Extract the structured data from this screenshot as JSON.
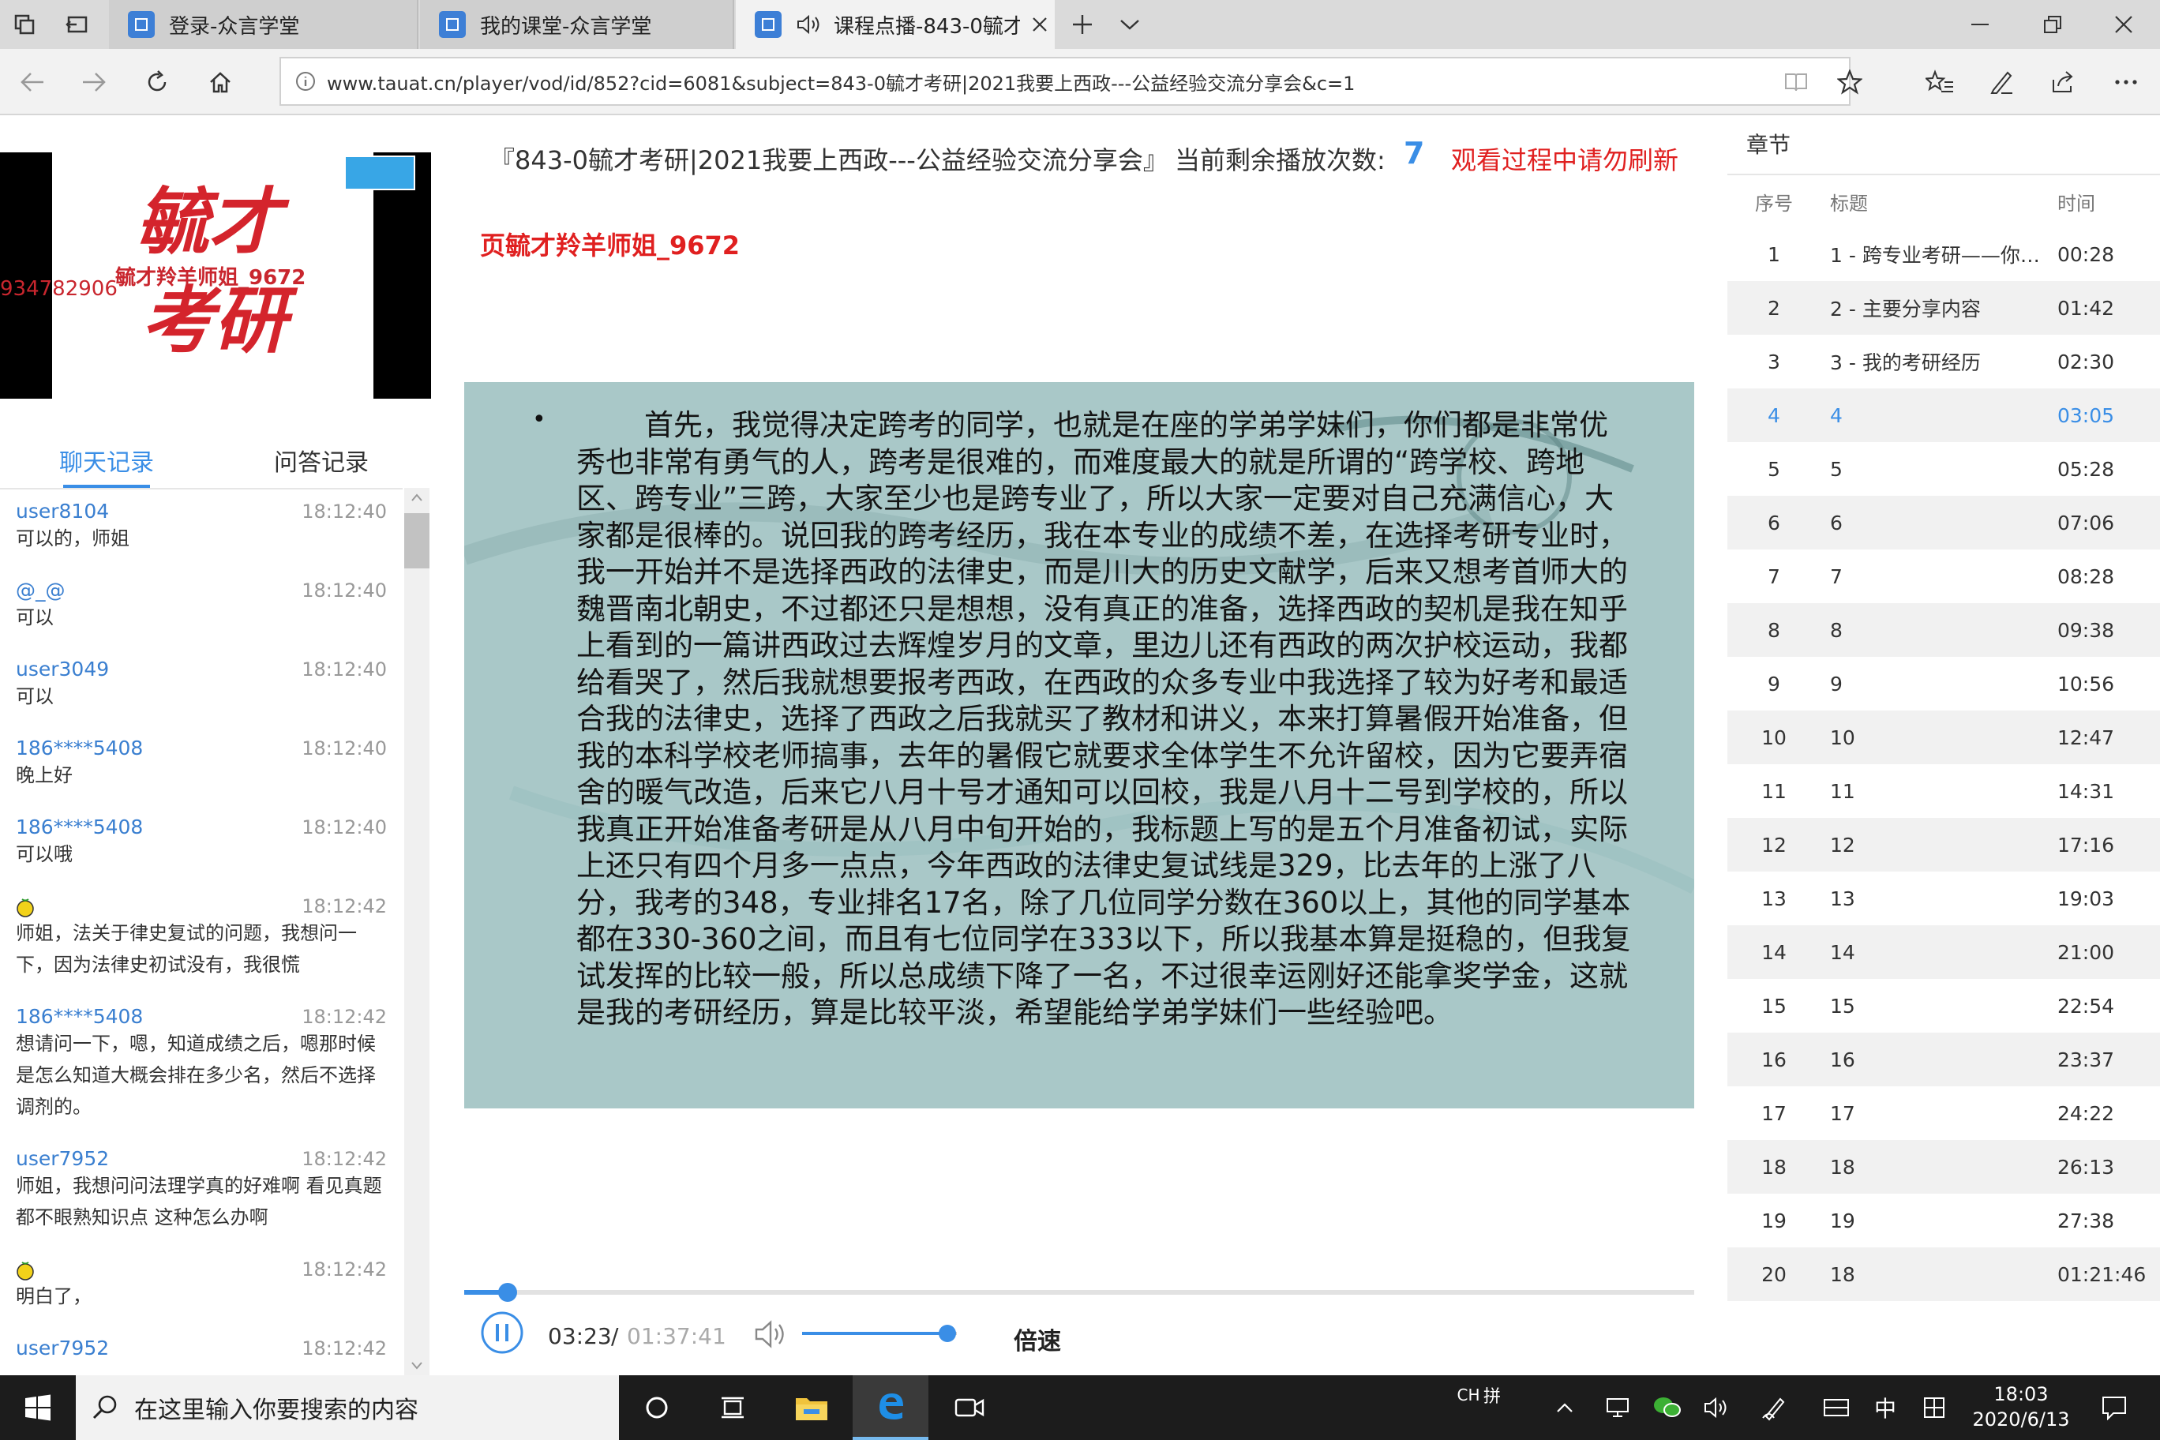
{
  "browser": {
    "tabs": [
      {
        "title": "登录-众言学堂",
        "active": false
      },
      {
        "title": "我的课堂-众言学堂",
        "active": false
      },
      {
        "title": "课程点播-843-0毓才",
        "active": true
      }
    ],
    "url": "www.tauat.cn/player/vod/id/852?cid=6081&subject=843-0毓才考研|2021我要上西政---公益经验交流分享会&c=1"
  },
  "left": {
    "thumb_overlay": "毓才羚羊师姐_9672",
    "thumb_id": "934782906",
    "tabs": {
      "chat": "聊天记录",
      "qa": "问答记录"
    },
    "messages": [
      {
        "user": "user8104",
        "time": "18:12:40",
        "text": "可以的，师姐"
      },
      {
        "user": "@_@",
        "time": "18:12:40",
        "text": "可以"
      },
      {
        "user": "user3049",
        "time": "18:12:40",
        "text": "可以"
      },
      {
        "user": "186****5408",
        "time": "18:12:40",
        "text": "晚上好"
      },
      {
        "user": "186****5408",
        "time": "18:12:40",
        "text": "可以哦"
      },
      {
        "user": "",
        "time": "18:12:42",
        "text": "师姐，法关于律史复试的问题，我想问一下，因为法律史初试没有，我很慌"
      },
      {
        "user": "186****5408",
        "time": "18:12:42",
        "text": "想请问一下，嗯，知道成绩之后，嗯那时候是怎么知道大概会排在多少名，然后不选择调剂的。"
      },
      {
        "user": "user7952",
        "time": "18:12:42",
        "text": "师姐，我想问问法理学真的好难啊 看见真题都不眼熟知识点 这种怎么办啊"
      },
      {
        "user": "",
        "time": "18:12:42",
        "text": "明白了，"
      },
      {
        "user": "user7952",
        "time": "18:12:42",
        "text": ""
      }
    ]
  },
  "player": {
    "course_title": "『843-0毓才考研|2021我要上西政---公益经验交流分享会』",
    "remaining_label": "当前剩余播放次数:",
    "remaining_count": "7",
    "refresh_warning": "观看过程中请勿刷新",
    "watermark": "页毓才羚羊师姐_9672",
    "slide_bullet": "•",
    "slide_text": "首先，我觉得决定跨考的同学，也就是在座的学弟学妹们，你们都是非常优秀也非常有勇气的人，跨考是很难的，而难度最大的就是所谓的“跨学校、跨地区、跨专业”三跨，大家至少也是跨专业了，所以大家一定要对自己充满信心，大家都是很棒的。说回我的跨考经历，我在本专业的成绩不差，在选择考研专业时，我一开始并不是选择西政的法律史，而是川大的历史文献学，后来又想考首师大的魏晋南北朝史，不过都还只是想想，没有真正的准备，选择西政的契机是我在知乎上看到的一篇讲西政过去辉煌岁月的文章，里边儿还有西政的两次护校运动，我都给看哭了，然后我就想要报考西政，在西政的众多专业中我选择了较为好考和最适合我的法律史，选择了西政之后我就买了教材和讲义，本来打算暑假开始准备，但我的本科学校老师搞事，去年的暑假它就要求全体学生不允许留校，因为它要弄宿舍的暖气改造，后来它八月十号才通知可以回校，我是八月十二号到学校的，所以我真正开始准备考研是从八月中旬开始的，我标题上写的是五个月准备初试，实际上还只有四个月多一点点，今年西政的法律史复试线是329，比去年的上涨了八分，我考的348，专业排名17名，除了几位同学分数在360以上，其他的同学基本都在330-360之间，而且有七位同学在333以下，所以我基本算是挺稳的，但我复试发挥的比较一般，所以总成绩下降了一名，不过很幸运刚好还能拿奖学金，这就是我的考研经历，算是比较平淡，希望能给学弟学妹们一些经验吧。",
    "time_current": "03:23",
    "time_sep": "/",
    "time_total": "01:37:41",
    "progress": 0.035,
    "volume": 0.94,
    "speed_label": "倍速"
  },
  "chapters": {
    "title": "章节",
    "headers": {
      "no": "序号",
      "title": "标题",
      "time": "时间"
    },
    "rows": [
      {
        "no": "1",
        "title": "1 - 跨专业考研——你准...",
        "time": "00:28"
      },
      {
        "no": "2",
        "title": "2 - 主要分享内容",
        "time": "01:42"
      },
      {
        "no": "3",
        "title": "3 - 我的考研经历",
        "time": "02:30"
      },
      {
        "no": "4",
        "title": "4",
        "time": "03:05",
        "active": true
      },
      {
        "no": "5",
        "title": "5",
        "time": "05:28"
      },
      {
        "no": "6",
        "title": "6",
        "time": "07:06"
      },
      {
        "no": "7",
        "title": "7",
        "time": "08:28"
      },
      {
        "no": "8",
        "title": "8",
        "time": "09:38"
      },
      {
        "no": "9",
        "title": "9",
        "time": "10:56"
      },
      {
        "no": "10",
        "title": "10",
        "time": "12:47"
      },
      {
        "no": "11",
        "title": "11",
        "time": "14:31"
      },
      {
        "no": "12",
        "title": "12",
        "time": "17:16"
      },
      {
        "no": "13",
        "title": "13",
        "time": "19:03"
      },
      {
        "no": "14",
        "title": "14",
        "time": "21:00"
      },
      {
        "no": "15",
        "title": "15",
        "time": "22:54"
      },
      {
        "no": "16",
        "title": "16",
        "time": "23:37"
      },
      {
        "no": "17",
        "title": "17",
        "time": "24:22"
      },
      {
        "no": "18",
        "title": "18",
        "time": "26:13"
      },
      {
        "no": "19",
        "title": "19",
        "time": "27:38"
      },
      {
        "no": "20",
        "title": "18",
        "time": "01:21:46"
      }
    ]
  },
  "taskbar": {
    "search_placeholder": "在这里输入你要搜索的内容",
    "ime_ch": "CH",
    "ime_pin": "拼",
    "lang": "中",
    "clock_time": "18:03",
    "clock_date": "2020/6/13"
  },
  "colors": {
    "accent": "#3a8ee6",
    "warning": "#e02020",
    "taskbar": "#1c1c1c",
    "slide_bg": "#a9c8c8"
  }
}
